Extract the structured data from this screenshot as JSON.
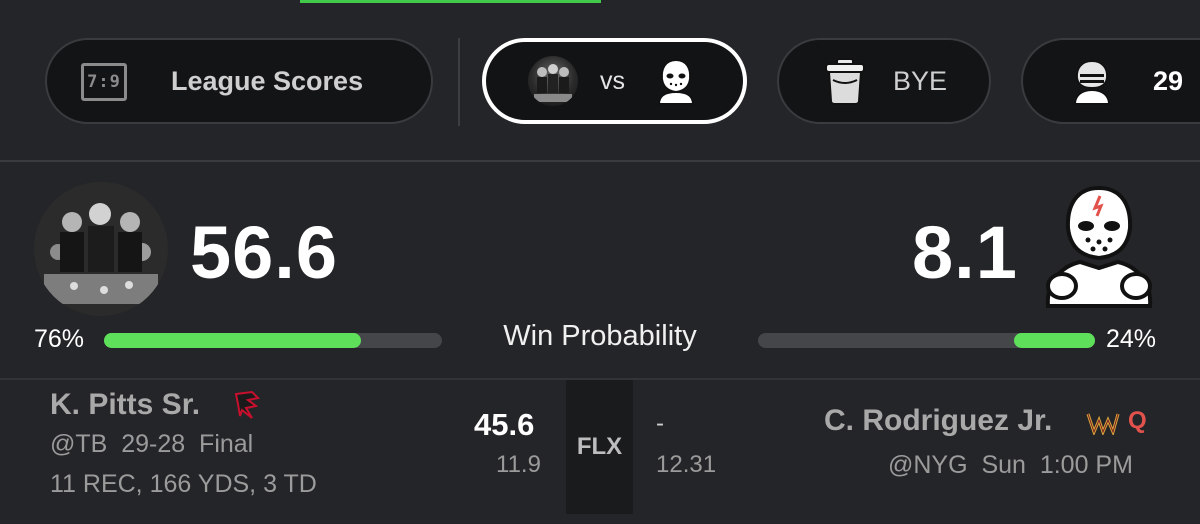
{
  "nav": {
    "league_scores_label": "League Scores",
    "calendar_icon_text": "7:9",
    "matchup_vs_label": "vs",
    "bye_label": "BYE",
    "partial_score_label": "29"
  },
  "matchup": {
    "home": {
      "score": "56.6",
      "win_pct": "76%",
      "win_fraction": 0.76
    },
    "away": {
      "score": "8.1",
      "win_pct": "24%",
      "win_fraction": 0.24
    },
    "win_probability_label": "Win Probability"
  },
  "player_row": {
    "slot": "FLX",
    "left": {
      "name": "K. Pitts Sr.",
      "team_logo": "falcons-logo-icon",
      "game": "@TB  29-28  Final",
      "stats": "11 REC, 166 YDS, 3 TD",
      "points": "45.6",
      "projection": "11.9"
    },
    "right": {
      "name": "C. Rodriguez Jr.",
      "team_logo": "commanders-logo-icon",
      "status": "Q",
      "game": "@NYG  Sun  1:00 PM",
      "points": "-",
      "projection": "12.31"
    }
  },
  "colors": {
    "background": "#242528",
    "accent_green": "#5ee05a",
    "injury_red": "#e2524d",
    "commanders_gold": "#d9a63b"
  }
}
